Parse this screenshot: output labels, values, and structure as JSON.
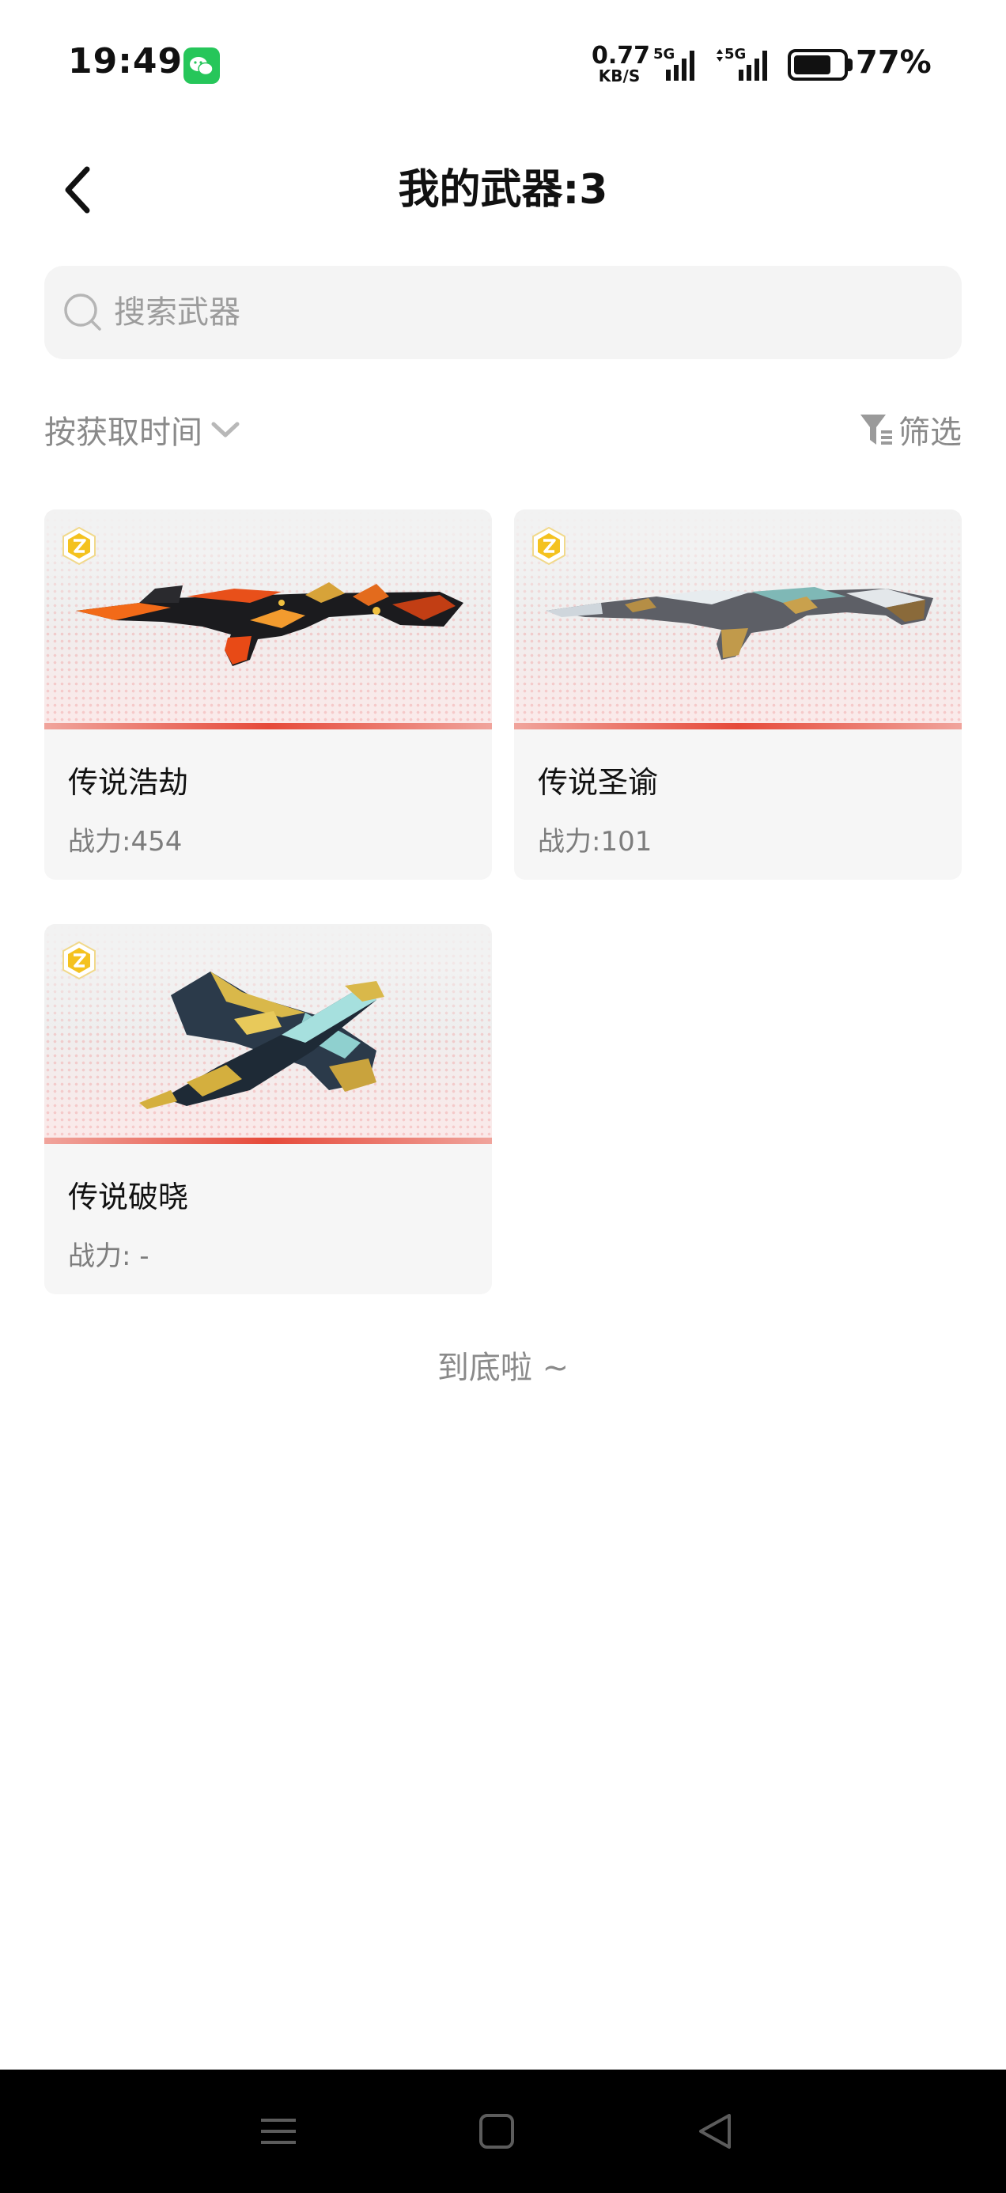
{
  "status_bar": {
    "time": "19:49",
    "net_speed_value": "0.77",
    "net_speed_unit": "KB/S",
    "signal1_label": "5G",
    "signal2_label": "5G",
    "battery_percent": "77%",
    "battery_level": 0.77
  },
  "header": {
    "title": "我的武器:3"
  },
  "search": {
    "placeholder": "搜索武器",
    "value": ""
  },
  "toolbar": {
    "sort_label": "按获取时间",
    "filter_label": "筛选"
  },
  "weapons": [
    {
      "name": "传说浩劫",
      "power": "战力:454"
    },
    {
      "name": "传说圣谕",
      "power": "战力:101"
    },
    {
      "name": "传说破晓",
      "power": "战力: -"
    }
  ],
  "footer": {
    "end_text": "到底啦 ~"
  },
  "colors": {
    "accent_bar": "#e64a3a",
    "badge": "#f2c21b",
    "wechat": "#26c65a"
  }
}
